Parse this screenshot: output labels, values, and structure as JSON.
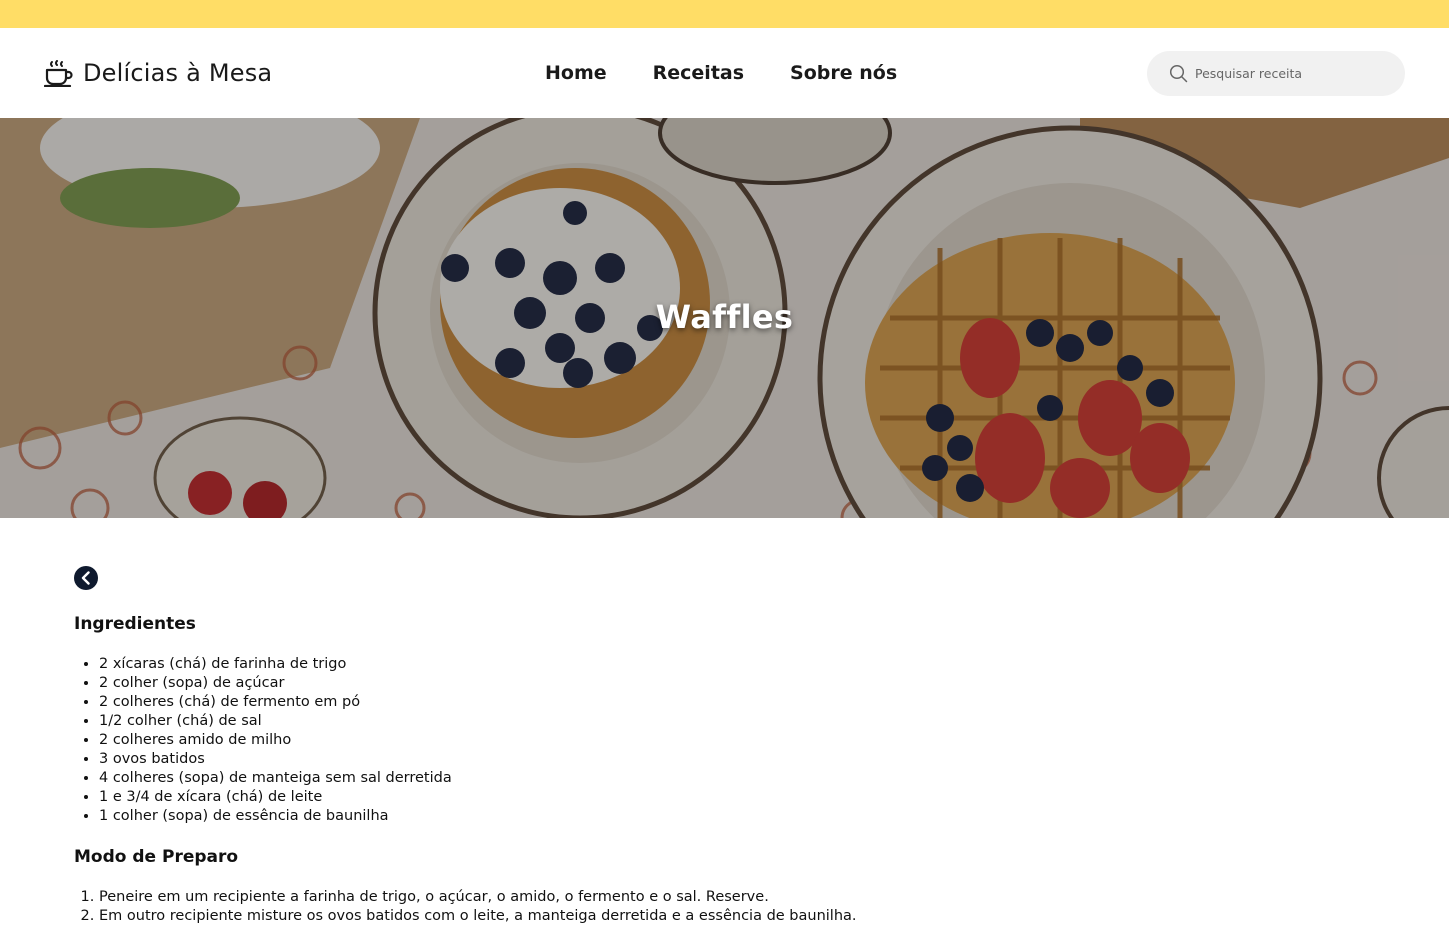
{
  "colors": {
    "top_strip": "#ffdd66",
    "accent_dark": "#0f1a2e"
  },
  "brand": {
    "icon": "coffee-cup-icon",
    "name": "Delícias à Mesa"
  },
  "nav": {
    "items": [
      {
        "label": "Home"
      },
      {
        "label": "Receitas"
      },
      {
        "label": "Sobre nós"
      }
    ]
  },
  "search": {
    "icon": "search-icon",
    "placeholder": "Pesquisar receita",
    "value": ""
  },
  "hero": {
    "title": "Waffles"
  },
  "back_button": {
    "icon": "chevron-left-icon"
  },
  "ingredients": {
    "title": "Ingredientes",
    "items": [
      "2 xícaras (chá) de farinha de trigo",
      "2 colher (sopa) de açúcar",
      "2 colheres (chá) de fermento em pó",
      "1/2 colher (chá) de sal",
      "2 colheres amido de milho",
      "3 ovos batidos",
      "4 colheres (sopa) de manteiga sem sal derretida",
      "1 e 3/4 de xícara (chá) de leite",
      "1 colher (sopa) de essência de baunilha"
    ]
  },
  "preparation": {
    "title": "Modo de Preparo",
    "steps": [
      "Peneire em um recipiente a farinha de trigo, o açúcar, o amido, o fermento e o sal. Reserve.",
      "Em outro recipiente misture os ovos batidos com o leite, a manteiga derretida e a essência de baunilha."
    ]
  }
}
